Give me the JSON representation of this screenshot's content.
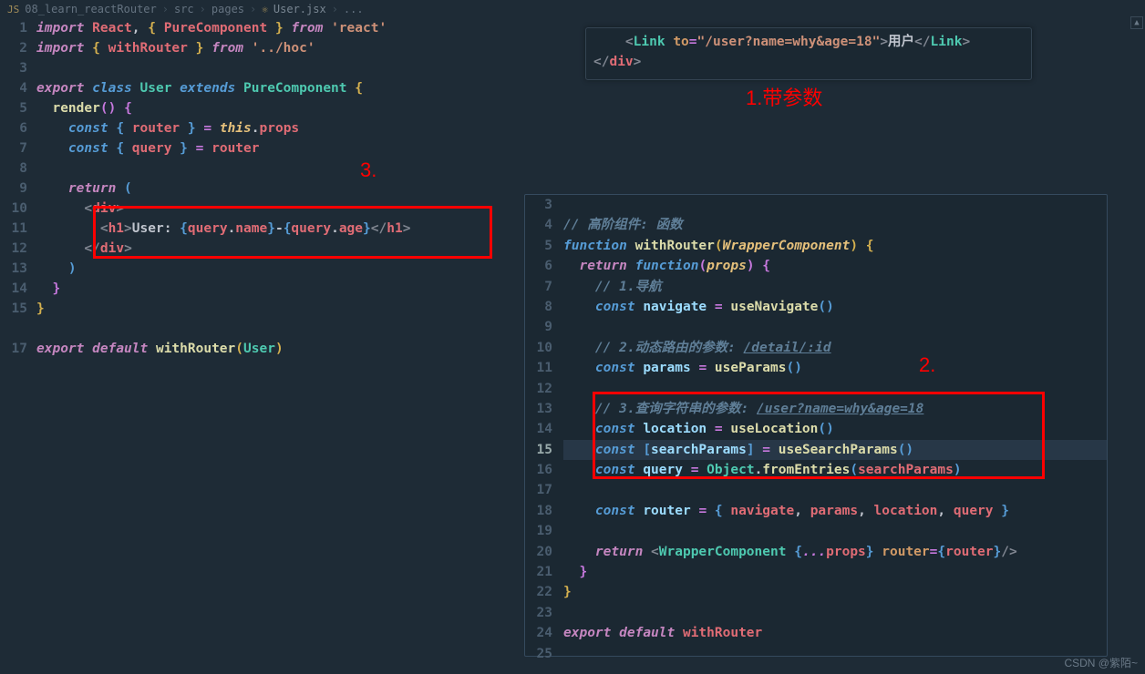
{
  "breadcrumb": {
    "project": "08_learn_reactRouter",
    "folder1": "src",
    "folder2": "pages",
    "file": "User.jsx",
    "more": "..."
  },
  "leftEditor": {
    "lineNumbers": [
      "1",
      "2",
      "3",
      "4",
      "5",
      "6",
      "7",
      "8",
      "9",
      "10",
      "11",
      "12",
      "13",
      "14",
      "15",
      "",
      "17"
    ],
    "l1": {
      "import": "import",
      "React": "React",
      "comma": ",",
      "brace1": "{ ",
      "Pure": "PureComponent",
      "brace2": " }",
      "from": "from",
      "react": "'react'"
    },
    "l2": {
      "import": "import",
      "brace1": "{ ",
      "withRouter": "withRouter",
      "brace2": " }",
      "from": "from",
      "path": "'../hoc'"
    },
    "l4": {
      "export": "export",
      "class": "class",
      "User": "User",
      "extends": "extends",
      "Pure": "PureComponent",
      "brace": "{"
    },
    "l5": {
      "render": "render",
      "paren": "()",
      "brace": "{"
    },
    "l6": {
      "const": "const",
      "braceo": "{ ",
      "router": "router",
      "bracec": " }",
      "eq": "=",
      "this": "this",
      "dot": ".",
      "props": "props"
    },
    "l7": {
      "const": "const",
      "braceo": "{ ",
      "query": "query",
      "bracec": " }",
      "eq": "=",
      "router": "router"
    },
    "l9": {
      "return": "return",
      "paren": "("
    },
    "l10": {
      "lt": "<",
      "div": "div",
      "gt": ">"
    },
    "l11": {
      "lt": "<",
      "h1": "h1",
      "gt": ">",
      "txt1": "User: ",
      "bo": "{",
      "q": "query",
      "d": ".",
      "name": "name",
      "bc": "}",
      "dash": "-",
      "bo2": "{",
      "q2": "query",
      "d2": ".",
      "age": "age",
      "bc2": "}",
      "lt2": "</",
      "h1b": "h1",
      "gt2": ">"
    },
    "l12": {
      "lt": "</",
      "div": "div",
      "gt": ">"
    },
    "l13": {
      "paren": ")"
    },
    "l14": {
      "brace": "}"
    },
    "l15": {
      "brace": "}"
    },
    "l17": {
      "export": "export",
      "default": "default",
      "withRouter": "withRouter",
      "paren": "(",
      "User": "User",
      "paren2": ")"
    }
  },
  "linkSnippet": {
    "l1": {
      "pad": "    ",
      "lt": "<",
      "Link": "Link",
      "sp": " ",
      "to": "to",
      "eq": "=",
      "str": "\"/user?name=why&age=18\"",
      "gt": ">",
      "txt": "用户",
      "lt2": "</",
      "Link2": "Link",
      "gt2": ">"
    },
    "l2": {
      "lt": "</",
      "div": "div",
      "gt": ">"
    }
  },
  "rightEditor": {
    "lineNumbers": [
      "3",
      "4",
      "5",
      "6",
      "7",
      "8",
      "9",
      "10",
      "11",
      "12",
      "13",
      "14",
      "15",
      "16",
      "17",
      "18",
      "19",
      "20",
      "21",
      "22",
      "23",
      "24",
      "25"
    ],
    "current": "15",
    "l4": {
      "c": "// ",
      "txt": "高阶组件: 函数"
    },
    "l5": {
      "function": "function",
      "withRouter": "withRouter",
      "po": "(",
      "Wrap": "WrapperComponent",
      "pc": ")",
      "bo": "{"
    },
    "l6": {
      "return": "return",
      "function": "function",
      "po": "(",
      "props": "props",
      "pc": ")",
      "bo": "{"
    },
    "l7": {
      "c": "// ",
      "txt": "1.导航"
    },
    "l8": {
      "const": "const",
      "nav": "navigate",
      "eq": "=",
      "useNav": "useNavigate",
      "p": "()"
    },
    "l10": {
      "c": "// ",
      "txt": "2.动态路由的参数: ",
      "path": "/detail/:id"
    },
    "l11": {
      "const": "const",
      "params": "params",
      "eq": "=",
      "useParams": "useParams",
      "p": "()"
    },
    "l13": {
      "c": "// ",
      "txt": "3.查询字符串的参数: ",
      "path": "/user?name=why&age=18"
    },
    "l14": {
      "const": "const",
      "loc": "location",
      "eq": "=",
      "useLoc": "useLocation",
      "p": "()"
    },
    "l15": {
      "const": "const",
      "bo": "[",
      "sp": "searchParams",
      "bc": "]",
      "eq": "=",
      "useSP": "useSearchParams",
      "p": "()"
    },
    "l16": {
      "const": "const",
      "query": "query",
      "eq": "=",
      "Object": "Object",
      "d": ".",
      "fromEntries": "fromEntries",
      "po": "(",
      "sp": "searchParams",
      "pc": ")"
    },
    "l18": {
      "const": "const",
      "router": "router",
      "eq": "=",
      "bo": "{ ",
      "nav": "navigate",
      "c1": ", ",
      "params": "params",
      "c2": ", ",
      "loc": "location",
      "c3": ", ",
      "query": "query",
      "bc": " }"
    },
    "l20": {
      "return": "return",
      "lt": "<",
      "Wrap": "WrapperComponent",
      "sp": " ",
      "bo": "{",
      "spread": "...",
      "props": "props",
      "bc": "}",
      "sp2": " ",
      "router": "router",
      "eq": "=",
      "bo2": "{",
      "routerv": "router",
      "bc2": "}",
      "gt": "/>"
    },
    "l21": {
      "brace": "}"
    },
    "l22": {
      "brace": "}"
    },
    "l24": {
      "export": "export",
      "default": "default",
      "withRouter": "withRouter"
    }
  },
  "annotations": {
    "a1": "1.带参数",
    "a2": "2.",
    "a3": "3."
  },
  "watermark": "CSDN @紫陌~"
}
